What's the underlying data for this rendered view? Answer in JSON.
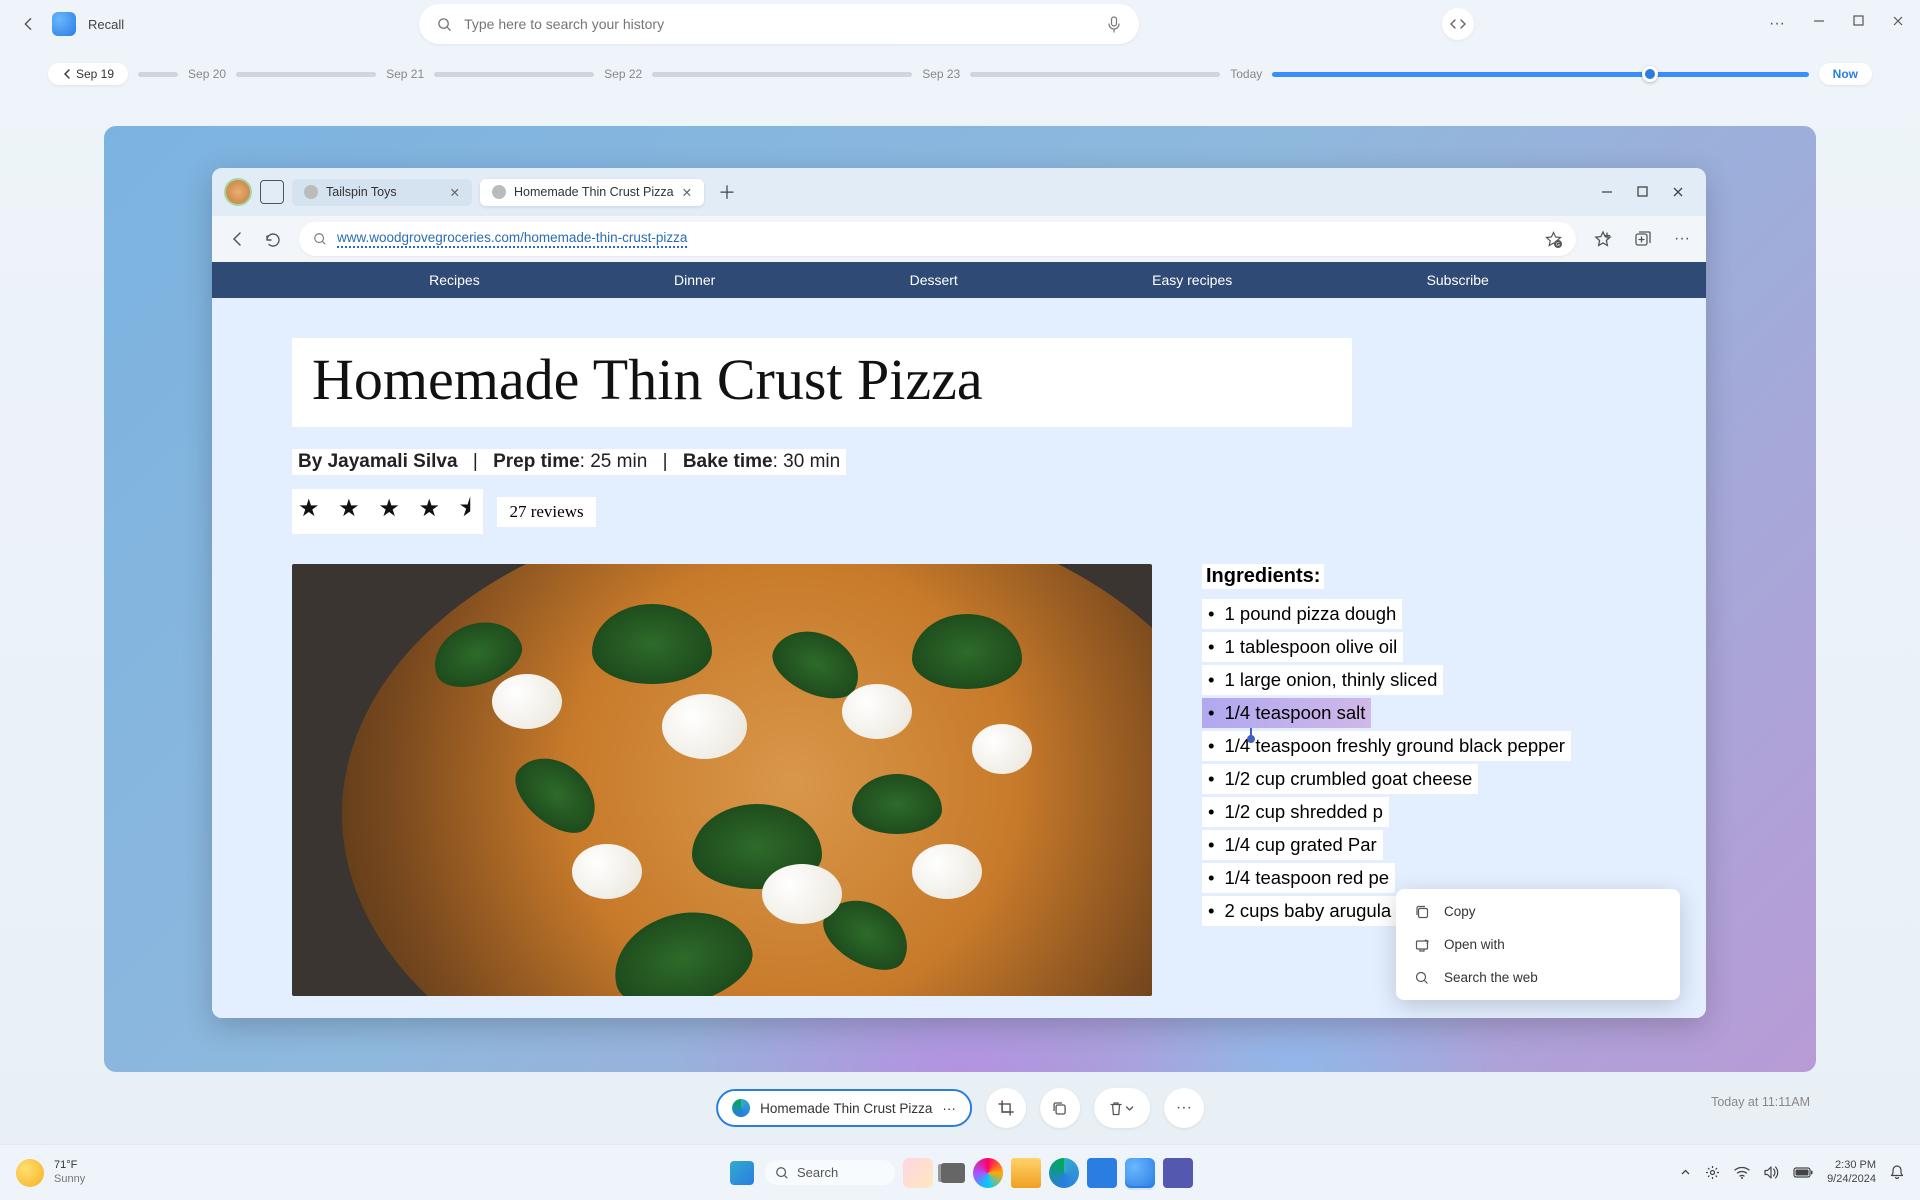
{
  "app": {
    "name": "Recall"
  },
  "search": {
    "placeholder": "Type here to search your history"
  },
  "timeline": {
    "current": "Sep 19",
    "dates": [
      "Sep 20",
      "Sep 21",
      "Sep 22",
      "Sep 23"
    ],
    "today": "Today",
    "now": "Now"
  },
  "browser": {
    "tabs": [
      {
        "title": "Tailspin Toys",
        "active": false
      },
      {
        "title": "Homemade Thin Crust Pizza",
        "active": true
      }
    ],
    "url": "www.woodgrovegroceries.com/homemade-thin-crust-pizza"
  },
  "site_nav": [
    "Recipes",
    "Dinner",
    "Dessert",
    "Easy recipes",
    "Subscribe"
  ],
  "recipe": {
    "title": "Homemade Thin Crust Pizza",
    "author": "Jayamali Silva",
    "prep_label": "Prep time",
    "prep_value": "25 min",
    "bake_label": "Bake time",
    "bake_value": "30 min",
    "reviews": "27 reviews",
    "ingredients_heading": "Ingredients:",
    "ingredients": [
      "1 pound pizza dough",
      "1 tablespoon olive oil",
      "1 large onion, thinly sliced",
      "1/4 teaspoon salt",
      "1/4 teaspoon freshly ground black pepper",
      "1/2 cup crumbled goat cheese",
      "1/2 cup shredded p",
      "1/4 cup grated Par",
      "1/4 teaspoon red pe",
      "2 cups baby arugula"
    ],
    "selected_index": 3
  },
  "context_menu": {
    "items": [
      {
        "icon": "copy",
        "label": "Copy"
      },
      {
        "icon": "open",
        "label": "Open with"
      },
      {
        "icon": "search",
        "label": "Search the web"
      }
    ]
  },
  "action_chip": {
    "label": "Homemade Thin Crust Pizza"
  },
  "timestamp": "Today at 11:11AM",
  "taskbar": {
    "temp": "71°F",
    "cond": "Sunny",
    "search": "Search",
    "time": "2:30 PM",
    "date": "9/24/2024"
  }
}
